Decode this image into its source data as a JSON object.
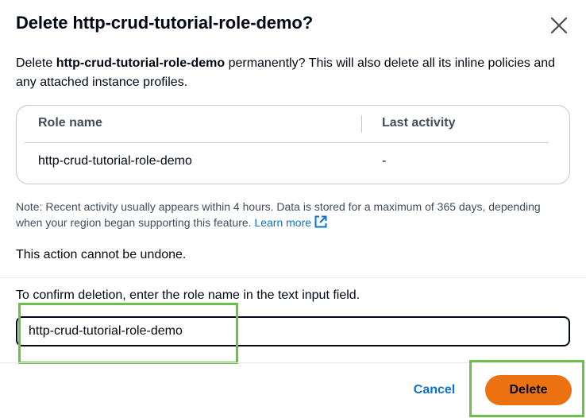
{
  "dialog": {
    "title": "Delete http-crud-tutorial-role-demo?",
    "description_prefix": "Delete ",
    "description_role": "http-crud-tutorial-role-demo",
    "description_suffix": " permanently? This will also delete all its inline policies and any attached instance profiles."
  },
  "table": {
    "columns": [
      "Role name",
      "Last activity"
    ],
    "rows": [
      [
        "http-crud-tutorial-role-demo",
        "-"
      ]
    ]
  },
  "note": {
    "text": "Note: Recent activity usually appears within 4 hours. Data is stored for a maximum of 365 days, depending when your region began supporting this feature. ",
    "link_label": "Learn more"
  },
  "warning": "This action cannot be undone.",
  "confirm": {
    "label": "To confirm deletion, enter the role name in the text input field.",
    "value": "http-crud-tutorial-role-demo"
  },
  "actions": {
    "cancel_label": "Cancel",
    "delete_label": "Delete"
  },
  "colors": {
    "primary_button": "#ec7211",
    "link": "#0972d3",
    "highlight": "#6cbf4a"
  },
  "icons": {
    "close": "close-icon",
    "external_link": "external-link-icon"
  }
}
